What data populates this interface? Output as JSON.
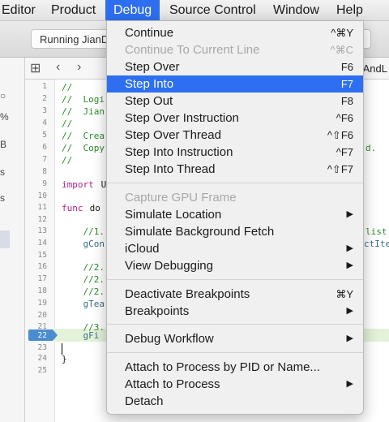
{
  "menubar": {
    "items": [
      "Editor",
      "Product",
      "Debug",
      "Source Control",
      "Window",
      "Help"
    ],
    "active": "Debug"
  },
  "toolbar": {
    "status": "Running JianD"
  },
  "navigator": {
    "glyphs": [
      "%",
      "B",
      "s",
      "s"
    ]
  },
  "jumpbar": {
    "crumb": "rAndL"
  },
  "editor": {
    "line_numbers": [
      "1",
      "2",
      "3",
      "4",
      "5",
      "6",
      "7",
      "8",
      "9",
      "10",
      "11",
      "12",
      "13",
      "14",
      "15",
      "16",
      "17",
      "18",
      "19",
      "20",
      "21",
      "22",
      "23",
      "24",
      "25"
    ],
    "current_line": "22",
    "code": {
      "l1": "//",
      "l2": "//  Logi",
      "l3": "//  Jian",
      "l4": "//",
      "l5": "//  Crea",
      "l6": "//  Copy",
      "l7": "//",
      "l9_kw": "import",
      "l9_rest": " U",
      "l11_kw": "func",
      "l11_rest": " do",
      "l13": "    //1.",
      "l13_tail": "list",
      "l14": "    gCon",
      "l14_tail": "ctIte",
      "l6_tail": "d.",
      "l16": "    //2.",
      "l17": "    //2.",
      "l18": "    //2.",
      "l19": "    gTea",
      "l21": "    //3.",
      "l22": "    gFi",
      "l24": "}"
    }
  },
  "debug_menu": {
    "items": [
      {
        "label": "Continue",
        "shortcut": "^⌘Y"
      },
      {
        "label": "Continue To Current Line",
        "shortcut": "^⌘C",
        "disabled": true
      },
      {
        "label": "Step Over",
        "shortcut": "F6"
      },
      {
        "label": "Step Into",
        "shortcut": "F7",
        "highlighted": true
      },
      {
        "label": "Step Out",
        "shortcut": "F8"
      },
      {
        "label": "Step Over Instruction",
        "shortcut": "^F6"
      },
      {
        "label": "Step Over Thread",
        "shortcut": "^⇧F6"
      },
      {
        "label": "Step Into Instruction",
        "shortcut": "^F7"
      },
      {
        "label": "Step Into Thread",
        "shortcut": "^⇧F7"
      },
      {
        "label": "Capture GPU Frame",
        "disabled": true
      },
      {
        "label": "Simulate Location",
        "submenu": true
      },
      {
        "label": "Simulate Background Fetch"
      },
      {
        "label": "iCloud",
        "submenu": true
      },
      {
        "label": "View Debugging",
        "submenu": true
      },
      {
        "label": "Deactivate Breakpoints",
        "shortcut": "⌘Y"
      },
      {
        "label": "Breakpoints",
        "submenu": true
      },
      {
        "label": "Debug Workflow",
        "submenu": true
      },
      {
        "label": "Attach to Process by PID or Name..."
      },
      {
        "label": "Attach to Process",
        "submenu": true
      },
      {
        "label": "Detach"
      }
    ],
    "submenu_arrow": "▶"
  },
  "colors": {
    "accent": "#2d6ff0",
    "comment": "#2e8a2e",
    "keyword": "#b0228a",
    "current_line": "#e3f2d9"
  }
}
